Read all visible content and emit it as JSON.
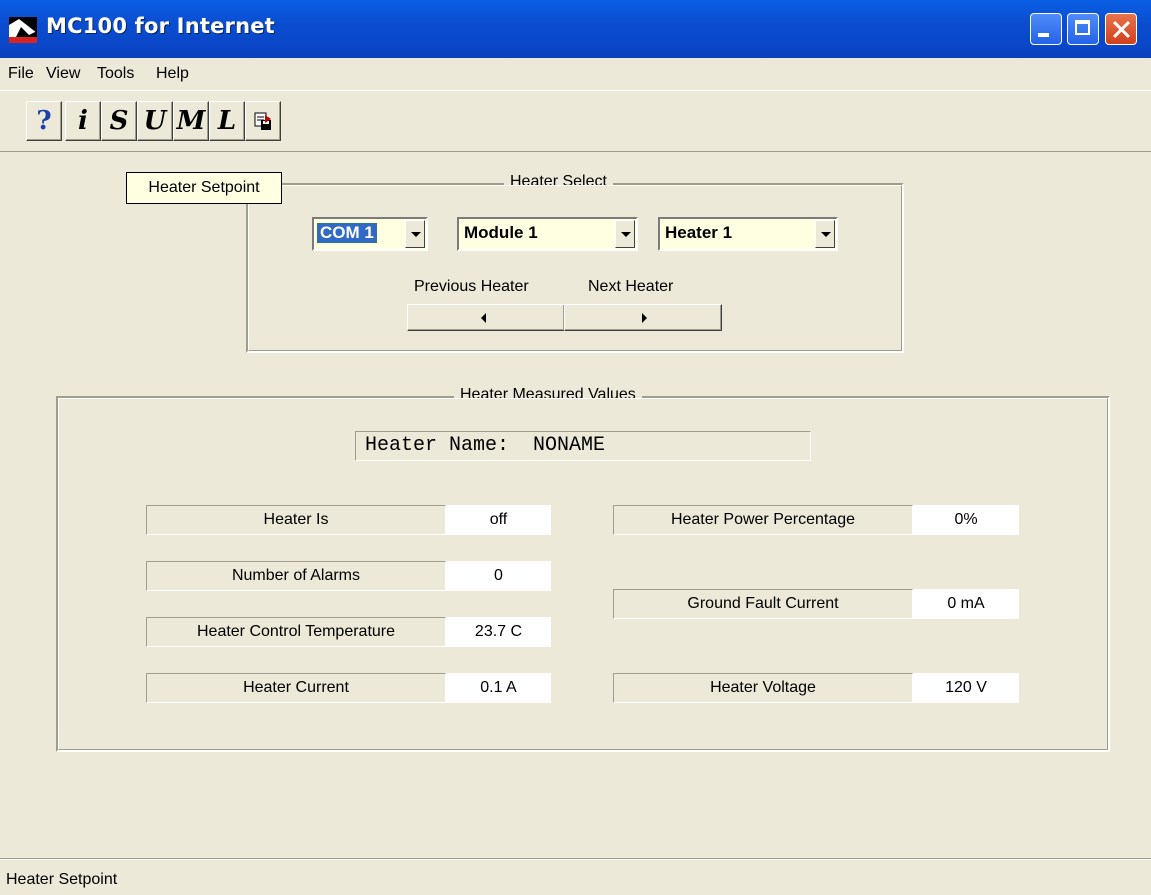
{
  "window": {
    "title": "MC100 for Internet"
  },
  "menu": [
    {
      "label": "File"
    },
    {
      "label": "View"
    },
    {
      "label": "Tools"
    },
    {
      "label": "Help"
    }
  ],
  "toolbar": {
    "buttons": [
      {
        "glyph": "?",
        "icon": "help-icon",
        "color": "#1a3fae"
      },
      {
        "glyph": "i",
        "icon": "info-icon",
        "color": "#000000"
      },
      {
        "glyph": "S",
        "icon": "s-icon",
        "color": "#000000"
      },
      {
        "glyph": "U",
        "icon": "u-icon",
        "color": "#000000"
      },
      {
        "glyph": "M",
        "icon": "m-icon",
        "color": "#000000"
      },
      {
        "glyph": "L",
        "icon": "l-icon",
        "color": "#000000"
      },
      {
        "glyph": "",
        "icon": "save-report-icon",
        "color": "#c00000"
      }
    ]
  },
  "tooltip": {
    "text": "Heater Setpoint"
  },
  "heater_select": {
    "title": "Heater Select",
    "com": "COM 1",
    "module": "Module 1",
    "heater": "Heater 1",
    "previous_label": "Previous Heater",
    "next_label": "Next Heater"
  },
  "measured": {
    "title": "Heater Measured Values",
    "heater_name": "Heater Name:  NONAME",
    "left_rows": [
      {
        "label": "Heater Is",
        "value": "off"
      },
      {
        "label": "Number of Alarms",
        "value": "0"
      },
      {
        "label": "Heater Control Temperature",
        "value": "23.7 C"
      },
      {
        "label": "Heater Current",
        "value": "0.1 A"
      }
    ],
    "right_rows": [
      {
        "label": "Heater Power Percentage",
        "value": "0%"
      },
      {
        "label": "Ground Fault Current",
        "value": "0 mA"
      },
      {
        "label": "Heater Voltage",
        "value": "120 V"
      }
    ]
  },
  "status": {
    "text": "Heater Setpoint"
  },
  "colors": {
    "titlebar": "#0a5fe4",
    "face": "#ece9d8",
    "tooltip_bg": "#ffffe1",
    "selection": "#316ac5"
  }
}
